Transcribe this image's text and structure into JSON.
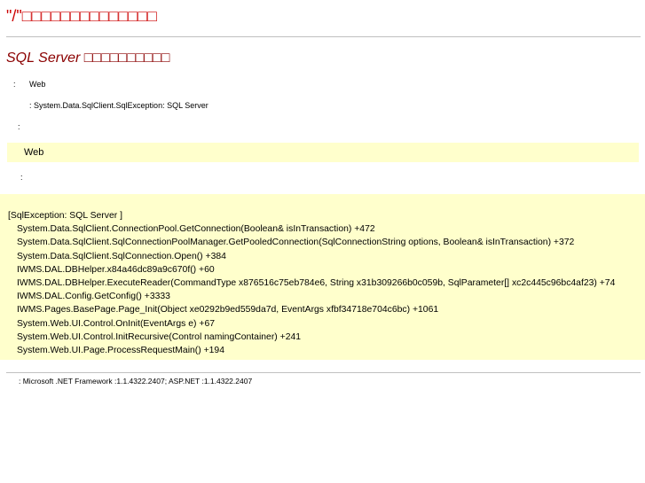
{
  "header": {
    "title": "\"/\"□□□□□□□□□□□□□□"
  },
  "error": {
    "title": "SQL Server □□□□□□□□□□",
    "description_label": ":",
    "description_value": "Web",
    "exception_detail": ": System.Data.SqlClient.SqlException: SQL Server",
    "source_error_label": ":",
    "source_box_text": "Web",
    "stack_trace_label": ":"
  },
  "stack_trace": {
    "header": "[SqlException: SQL Server            ]",
    "frames": [
      "System.Data.SqlClient.ConnectionPool.GetConnection(Boolean& isInTransaction) +472",
      "System.Data.SqlClient.SqlConnectionPoolManager.GetPooledConnection(SqlConnectionString options, Boolean& isInTransaction) +372",
      "System.Data.SqlClient.SqlConnection.Open() +384",
      "IWMS.DAL.DBHelper.x84a46dc89a9c670f() +60",
      "IWMS.DAL.DBHelper.ExecuteReader(CommandType x876516c75eb784e6, String x31b309266b0c059b, SqlParameter[] xc2c445c96bc4af23) +74",
      "IWMS.DAL.Config.GetConfig() +3333",
      "IWMS.Pages.BasePage.Page_Init(Object xe0292b9ed559da7d, EventArgs xfbf34718e704c6bc) +1061",
      "System.Web.UI.Control.OnInit(EventArgs e) +67",
      "System.Web.UI.Control.InitRecursive(Control namingContainer) +241",
      "System.Web.UI.Page.ProcessRequestMain() +194"
    ]
  },
  "footer": {
    "version_info": ": Microsoft .NET Framework   :1.1.4322.2407; ASP.NET   :1.1.4322.2407"
  },
  "colors": {
    "title": "#cc0000",
    "subtitle": "#8b0000",
    "code_background": "#ffffcc",
    "rule": "#c0c0c0"
  }
}
